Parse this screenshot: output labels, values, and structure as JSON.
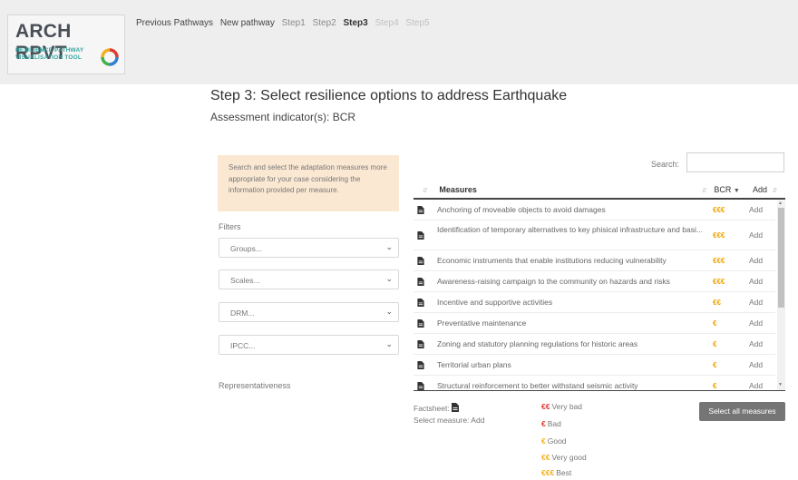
{
  "logo": {
    "title": "ARCH RPVT",
    "subtitle_line1": "RESILIENCE PATHWAY",
    "subtitle_line2": "VISUALISATION TOOL"
  },
  "nav": {
    "items": [
      "Previous Pathways",
      "New pathway",
      "Step1",
      "Step2",
      "Step3",
      "Step4",
      "Step5"
    ]
  },
  "page": {
    "title": "Step 3: Select resilience options to address Earthquake",
    "subtitle": "Assessment indicator(s): BCR"
  },
  "info_text": "Search and select the adaptation measures more appropriate for your case considering the information provided per measure.",
  "filters": {
    "label": "Filters",
    "selects": [
      "Groups...",
      "Scales...",
      "DRM...",
      "IPCC..."
    ],
    "representativeness_label": "Representativeness"
  },
  "search": {
    "label": "Search:",
    "value": ""
  },
  "table": {
    "headers": {
      "measures": "Measures",
      "bcr": "BCR",
      "add": "Add"
    },
    "rows": [
      {
        "measure": "Anchoring of moveable objects to avoid damages",
        "bcr": "€€€",
        "add": "Add"
      },
      {
        "measure": "Identification of temporary alternatives to key phisical infrastructure and basi...",
        "bcr": "€€€",
        "add": "Add"
      },
      {
        "measure": "Economic instruments that enable institutions reducing vulnerability",
        "bcr": "€€€",
        "add": "Add"
      },
      {
        "measure": "Awareness-raising campaign to the community on hazards and risks",
        "bcr": "€€€",
        "add": "Add"
      },
      {
        "measure": "Incentive and supportive activities",
        "bcr": "€€",
        "add": "Add"
      },
      {
        "measure": "Preventative maintenance",
        "bcr": "€",
        "add": "Add"
      },
      {
        "measure": "Zoning and statutory planning regulations for historic areas",
        "bcr": "€",
        "add": "Add"
      },
      {
        "measure": "Territorial urban plans",
        "bcr": "€",
        "add": "Add"
      },
      {
        "measure": "Structural reinforcement to better withstand seismic activity",
        "bcr": "€",
        "add": "Add"
      }
    ]
  },
  "footer": {
    "factsheet_label": "Factsheet:",
    "select_measure_label": "Select measure: Add",
    "select_all_button": "Select all measures"
  },
  "legend": [
    {
      "symbol": "€€",
      "label": "Very bad",
      "color": "#e03a2f"
    },
    {
      "symbol": "€",
      "label": "Bad",
      "color": "#e03a2f"
    },
    {
      "symbol": "€",
      "label": "Good",
      "color": "#f2b01e"
    },
    {
      "symbol": "€€",
      "label": "Very good",
      "color": "#f2b01e"
    },
    {
      "symbol": "€€€",
      "label": "Best",
      "color": "#f2b01e"
    }
  ]
}
